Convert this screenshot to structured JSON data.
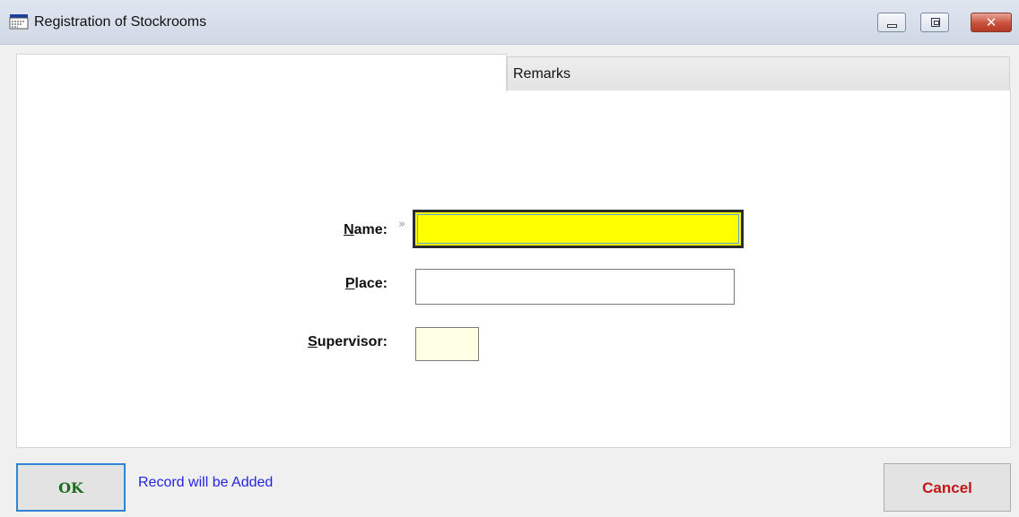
{
  "window": {
    "title": "Registration of Stockrooms",
    "icon": "form-app-icon",
    "controls": [
      "minimize-icon",
      "maximize-icon",
      "close-icon"
    ]
  },
  "tabs": [
    {
      "label": "",
      "active": true
    },
    {
      "label": "Remarks",
      "active": false
    }
  ],
  "form": {
    "name": {
      "label_accel": "N",
      "label_rest": "ame:",
      "value": "",
      "required_marker": "»",
      "highlight": "#ffff00"
    },
    "place": {
      "label_accel": "P",
      "label_rest": "lace:",
      "value": ""
    },
    "supervisor": {
      "label_accel": "S",
      "label_rest": "upervisor:",
      "value": "",
      "bg": "#ffffe4"
    }
  },
  "footer": {
    "ok_label": "OK",
    "status": "Record will be Added",
    "cancel_label": "Cancel"
  },
  "colors": {
    "ok_text": "#1d6b1d",
    "status_text": "#2424e0",
    "cancel_text": "#c41515",
    "focus_border": "#2f86d2"
  }
}
